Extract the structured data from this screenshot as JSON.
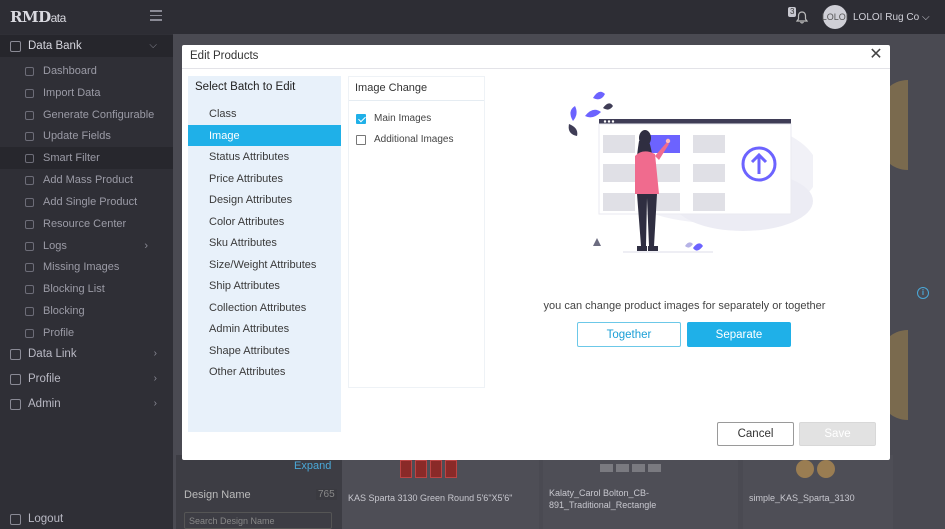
{
  "app": {
    "logo_main": "RMD",
    "logo_sub": "ata",
    "notification_count": "3",
    "avatar_text": "LOLOI",
    "company_name": "LOLOI Rug Co"
  },
  "sidebar": {
    "data_bank": "Data Bank",
    "items": [
      {
        "label": "Dashboard",
        "icon": "grid-icon"
      },
      {
        "label": "Import Data",
        "icon": "import-icon"
      },
      {
        "label": "Generate Configurable",
        "icon": "settings-icon"
      },
      {
        "label": "Update Fields",
        "icon": "update-icon"
      },
      {
        "label": "Smart Filter",
        "icon": "filter-icon"
      },
      {
        "label": "Add Mass Product",
        "icon": "plus-icon"
      },
      {
        "label": "Add Single Product",
        "icon": "plus-circle-icon"
      },
      {
        "label": "Resource Center",
        "icon": "resource-icon"
      },
      {
        "label": "Logs",
        "icon": "logs-icon"
      },
      {
        "label": "Missing Images",
        "icon": "image-icon"
      },
      {
        "label": "Blocking List",
        "icon": "block-icon"
      },
      {
        "label": "Blocking",
        "icon": "block-icon"
      },
      {
        "label": "Profile",
        "icon": "user-icon"
      }
    ],
    "sections": [
      "Data Link",
      "Profile",
      "Admin"
    ],
    "logout": "Logout"
  },
  "background": {
    "expand": "Expand",
    "design_name": "Design Name",
    "design_count": "765",
    "search_placeholder": "Search Design Name",
    "cards": [
      {
        "label": "KAS Sparta 3130 Green Round 5'6\"X5'6\""
      },
      {
        "label": "Kalaty_Carol Bolton_CB-891_Traditional_Rectangle"
      },
      {
        "label": "simple_KAS_Sparta_3130"
      }
    ]
  },
  "modal": {
    "title": "Edit Products",
    "batch_heading": "Select Batch to Edit",
    "batch_items": [
      "Class",
      "Image",
      "Status Attributes",
      "Price Attributes",
      "Design Attributes",
      "Color Attributes",
      "Sku Attributes",
      "Size/Weight Attributes",
      "Ship Attributes",
      "Collection Attributes",
      "Admin Attributes",
      "Shape Attributes",
      "Other Attributes"
    ],
    "active_batch": "Image",
    "change_heading": "Image Change",
    "options": [
      {
        "label": "Main Images",
        "checked": true
      },
      {
        "label": "Additional Images",
        "checked": false
      }
    ],
    "description": "you can change product images for separately or together",
    "together_label": "Together",
    "separate_label": "Separate",
    "cancel_label": "Cancel",
    "save_label": "Save"
  },
  "colors": {
    "accent": "#1fb0e8",
    "batch_bg": "#e8f1fa",
    "illustration_purple": "#6c63ff",
    "illustration_pink": "#f06b8e"
  }
}
